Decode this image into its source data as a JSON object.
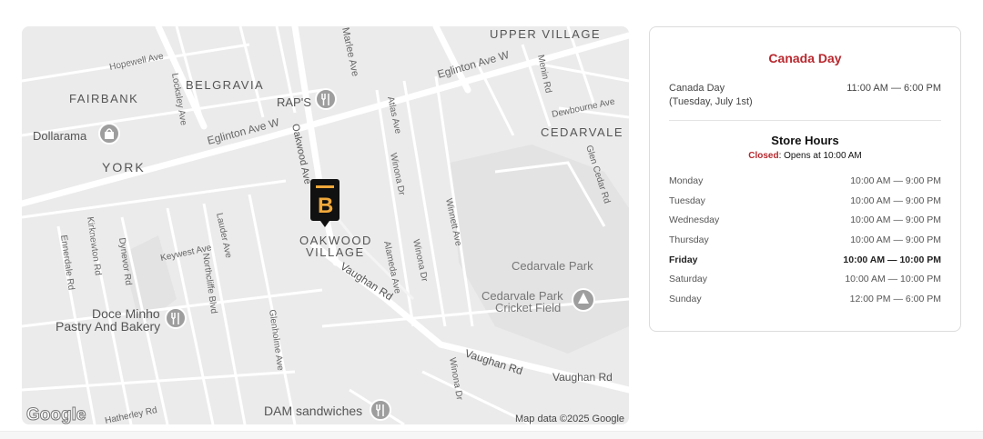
{
  "map": {
    "labels": {
      "upper_village": "UPPER VILLAGE",
      "hopewell": "Hopewell Ave",
      "belgravia": "BELGRAVIA",
      "fairbank": "FAIRBANK",
      "locksley": "Locksley Ave",
      "marlee": "Marlee Ave",
      "eglinton_ne": "Eglinton Ave W",
      "menin": "Menin Rd",
      "raps": "RAP'S",
      "dewbourne": "Dewbourne Ave",
      "dollarama": "Dollarama",
      "eglinton_w": "Eglinton Ave W",
      "oakwood_ave": "Oakwood Ave",
      "atlas": "Atlas Ave",
      "cedarvale": "CEDARVALE",
      "york": "YORK",
      "glen_cedar": "Glen Cedar Rd",
      "winona1": "Winona Dr",
      "winnett": "Winnett Ave",
      "oakwood_village_1": "OAKWOOD",
      "oakwood_village_2": "VILLAGE",
      "keywest": "Keywest Ave",
      "lauder": "Lauder Ave",
      "kirknewton": "Kirknewton Rd",
      "ennerdale": "Ennerdale Rd",
      "dynevor": "Dynevor Rd",
      "doce": "Doce Minho",
      "northcliffe": "Northcliffe Blvd",
      "cedarvale_park": "Cedarvale Park",
      "alameda": "Alameda Ave",
      "winona2": "Winona Dr",
      "vaughan1": "Vaughan Rd",
      "cedarvale_cricket_1": "Cedarvale Park",
      "cedarvale_cricket_2": "Cricket Field",
      "doce_2": "Pastry And Bakery",
      "glenholme": "Glenholme Ave",
      "vaughan2": "Vaughan Rd",
      "vaughan3": "Vaughan Rd",
      "winona3": "Winona Dr",
      "google": "Google",
      "hatherley": "Hatherley Rd",
      "dam": "DAM sandwiches",
      "attribution": "Map data ©2025 Google"
    },
    "marker_letter": "B",
    "icons": {
      "restaurant": "fork-knife-icon",
      "shopping": "shopping-bag-icon",
      "park": "park-marker-icon",
      "store": "store-marker-icon"
    },
    "colors": {
      "map_bg": "#ebebeb",
      "road": "#ffffff",
      "poi_icon": "#9e9e9e",
      "marker": "#111111",
      "marker_letter": "#f2a93b"
    }
  },
  "holiday": {
    "title": "Canada Day",
    "name_line1": "Canada Day",
    "name_line2": "(Tuesday, July 1st)",
    "hours": "11:00 AM — 6:00 PM"
  },
  "store_hours": {
    "title": "Store Hours",
    "status_label": "Closed",
    "status_rest": ": Opens at 10:00 AM",
    "days": [
      {
        "day": "Monday",
        "hours": "10:00 AM — 9:00 PM"
      },
      {
        "day": "Tuesday",
        "hours": "10:00 AM — 9:00 PM"
      },
      {
        "day": "Wednesday",
        "hours": "10:00 AM — 9:00 PM"
      },
      {
        "day": "Thursday",
        "hours": "10:00 AM — 9:00 PM"
      },
      {
        "day": "Friday",
        "hours": "10:00 AM — 10:00 PM"
      },
      {
        "day": "Saturday",
        "hours": "10:00 AM — 10:00 PM"
      },
      {
        "day": "Sunday",
        "hours": "12:00 PM — 6:00 PM"
      }
    ],
    "highlight_day": "Friday"
  },
  "colors": {
    "accent_red": "#b8282e"
  }
}
